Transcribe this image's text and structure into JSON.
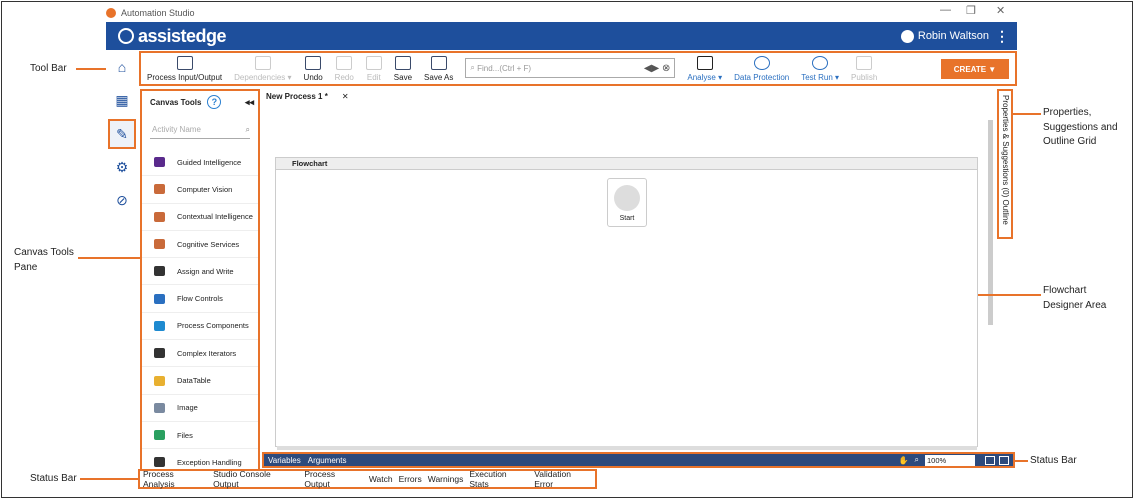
{
  "window": {
    "title": "Automation Studio",
    "controls": [
      "—",
      "❐",
      "✕"
    ]
  },
  "header": {
    "brand": "assistedge",
    "user": "Robin Waltson",
    "menu_glyph": "⋮"
  },
  "toolbar": {
    "process_io": "Process Input/Output",
    "dependencies": "Dependencies ▾",
    "undo": "Undo",
    "redo": "Redo",
    "edit": "Edit",
    "save": "Save",
    "save_as": "Save As",
    "find_placeholder": "Find...(Ctrl + F)",
    "analyse": "Analyse ▾",
    "data_protection": "Data Protection",
    "test_run": "Test Run ▾",
    "publish": "Publish",
    "create": "CREATE ▼"
  },
  "nav": {
    "home": "⌂",
    "apps": "▦",
    "edit": "✎",
    "settings": "⚙",
    "explore": "⊘"
  },
  "canvas_tools": {
    "title": "Canvas Tools",
    "help": "?",
    "collapse": "◂◂",
    "search_placeholder": "Activity Name",
    "items": [
      {
        "label": "Guided Intelligence",
        "color": "#5a2a8c"
      },
      {
        "label": "Computer Vision",
        "color": "#c96a3a"
      },
      {
        "label": "Contextual Intelligence",
        "color": "#c96a3a"
      },
      {
        "label": "Cognitive Services",
        "color": "#c96a3a"
      },
      {
        "label": "Assign and Write",
        "color": "#333333"
      },
      {
        "label": "Flow Controls",
        "color": "#2a6fc0"
      },
      {
        "label": "Process Components",
        "color": "#1e8ad0"
      },
      {
        "label": "Complex Iterators",
        "color": "#333333"
      },
      {
        "label": "DataTable",
        "color": "#e8b030"
      },
      {
        "label": "Image",
        "color": "#7a8aa0"
      },
      {
        "label": "Files",
        "color": "#2aa060"
      },
      {
        "label": "Exception Handling",
        "color": "#333333"
      }
    ]
  },
  "document": {
    "tab": "New Process 1 *",
    "tab_close": "✕",
    "flowchart_title": "Flowchart",
    "start_label": "Start"
  },
  "right_pane": {
    "text": "Properties & Suggestions (0)   Outline"
  },
  "status": {
    "variables": "Variables",
    "arguments": "Arguments",
    "zoom": "100%"
  },
  "output_tabs": [
    "Process Analysis",
    "Studio Console Output",
    "Process Output",
    "Watch",
    "Errors",
    "Warnings",
    "Execution Stats",
    "Validation Error"
  ],
  "callouts": {
    "tool_bar": "Tool Bar",
    "canvas_tools_pane": "Canvas Tools Pane",
    "status_bar_left": "Status Bar",
    "properties": "Properties, Suggestions and Outline Grid",
    "flowchart_area": "Flowchart Designer Area",
    "status_bar_right": "Status Bar"
  },
  "colors": {
    "accent": "#e8732a",
    "brand": "#1e4f9c"
  }
}
